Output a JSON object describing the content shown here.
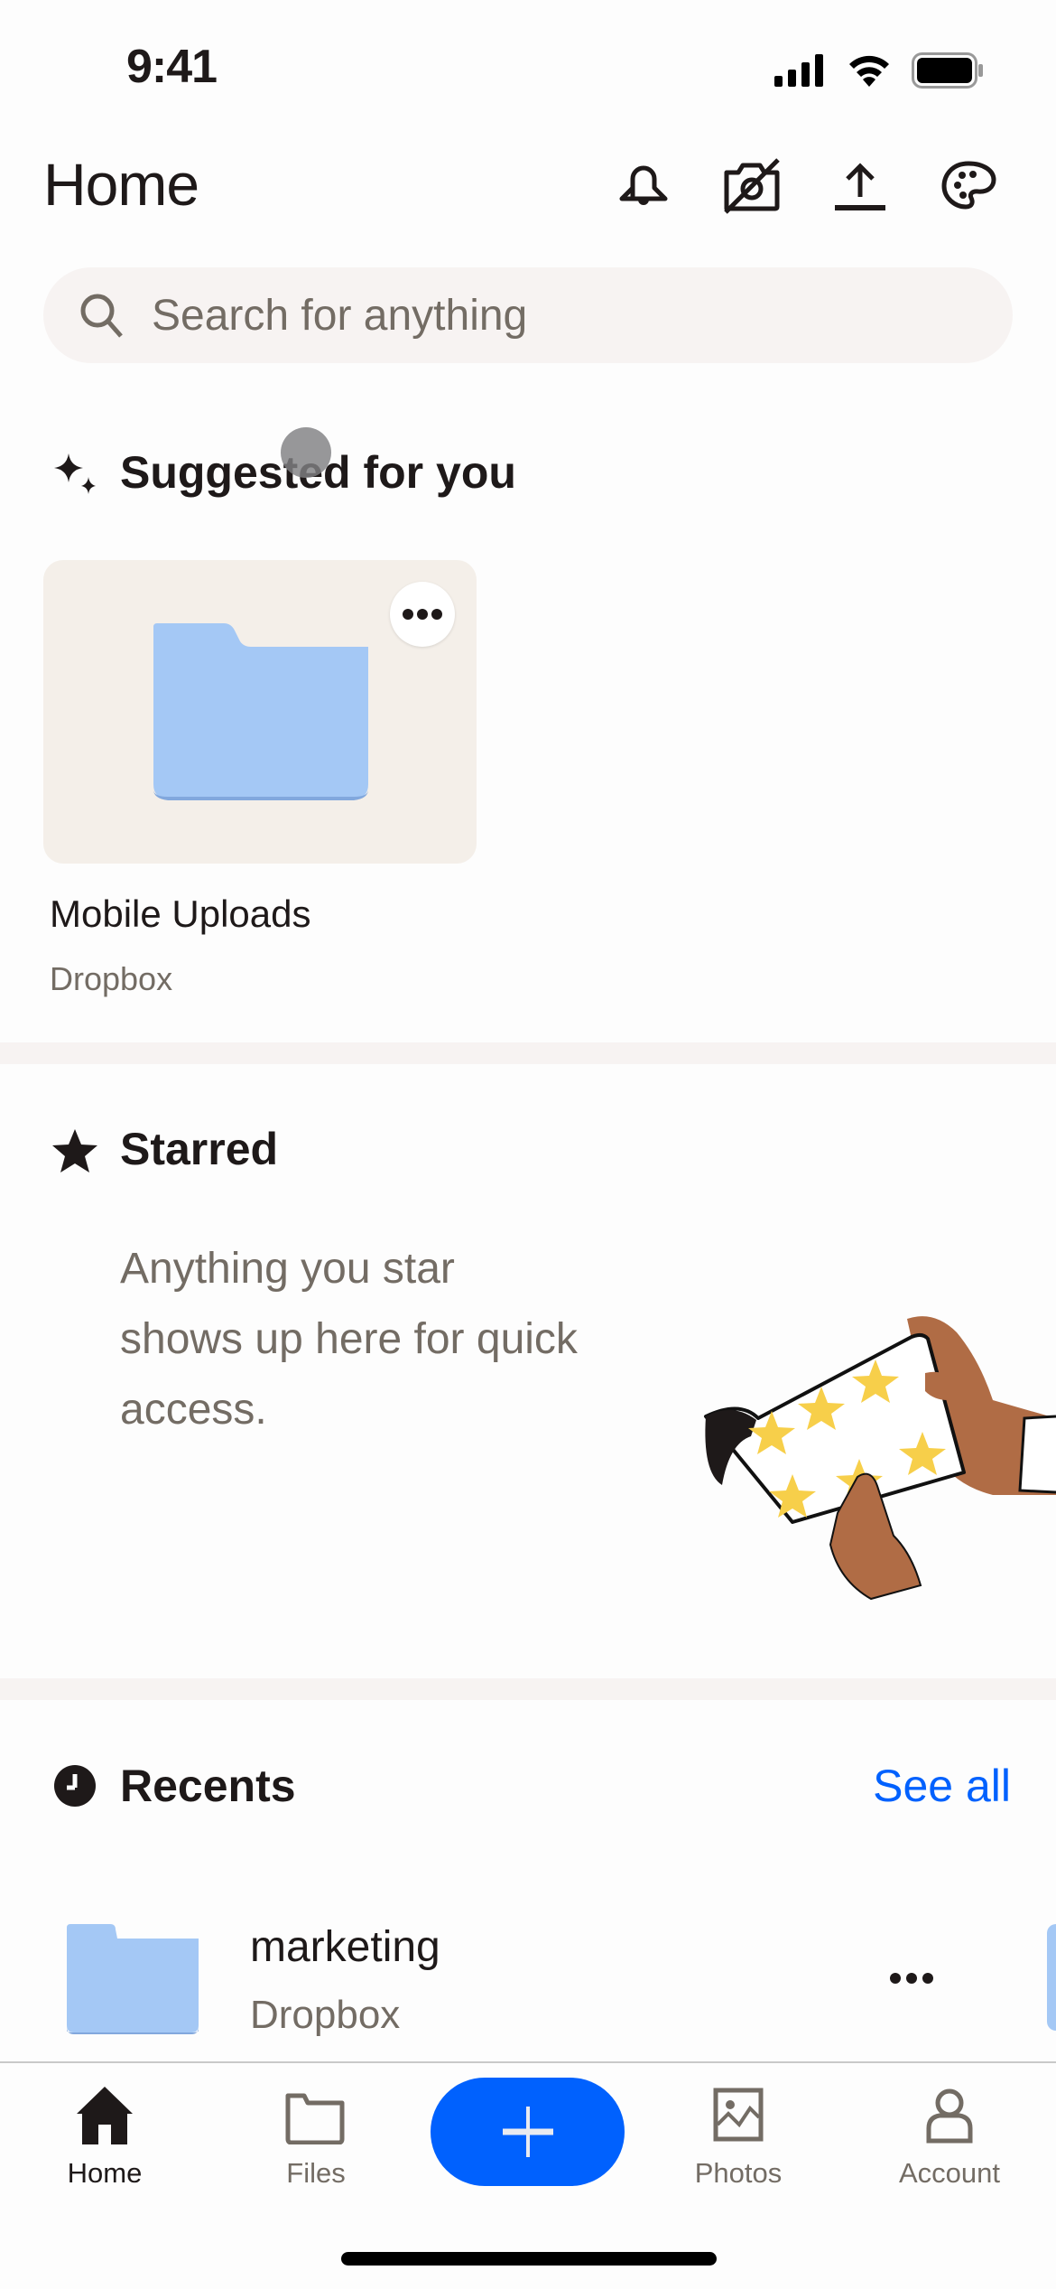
{
  "status_bar": {
    "time": "9:41",
    "icons": [
      "cellular-signal-icon",
      "wifi-icon",
      "battery-icon"
    ]
  },
  "header": {
    "title": "Home",
    "actions": [
      {
        "name": "notifications",
        "icon": "bell-icon"
      },
      {
        "name": "camera-uploads-off",
        "icon": "camera-off-icon"
      },
      {
        "name": "upload",
        "icon": "upload-icon"
      },
      {
        "name": "theme",
        "icon": "palette-icon"
      }
    ]
  },
  "search": {
    "placeholder": "Search for anything",
    "value": ""
  },
  "suggested": {
    "title": "Suggested for you",
    "icon": "sparkle-icon",
    "items": [
      {
        "name": "Mobile Uploads",
        "location": "Dropbox",
        "icon": "folder-icon"
      }
    ]
  },
  "starred": {
    "title": "Starred",
    "icon": "star-icon",
    "empty_text": "Anything you star shows up here for quick access.",
    "empty_lines": [
      "Anything you star",
      "shows up here for quick",
      "access."
    ]
  },
  "recents": {
    "title": "Recents",
    "icon": "clock-icon",
    "see_all": "See all",
    "items": [
      {
        "name": "marketing",
        "location": "Dropbox",
        "icon": "folder-icon"
      }
    ]
  },
  "bottom_nav": {
    "items": [
      {
        "label": "Home",
        "icon": "home-icon",
        "active": true
      },
      {
        "label": "Files",
        "icon": "folder-outline-icon",
        "active": false
      },
      {
        "label": "Photos",
        "icon": "image-icon",
        "active": false
      },
      {
        "label": "Account",
        "icon": "person-icon",
        "active": false
      }
    ],
    "create_button": {
      "icon": "plus-icon"
    }
  },
  "colors": {
    "accent": "#0061fe",
    "text_primary": "#1e1919",
    "text_secondary": "#736c64",
    "surface": "#f7f3f2",
    "card": "#f4efe9",
    "folder": "#a4c8f5"
  }
}
